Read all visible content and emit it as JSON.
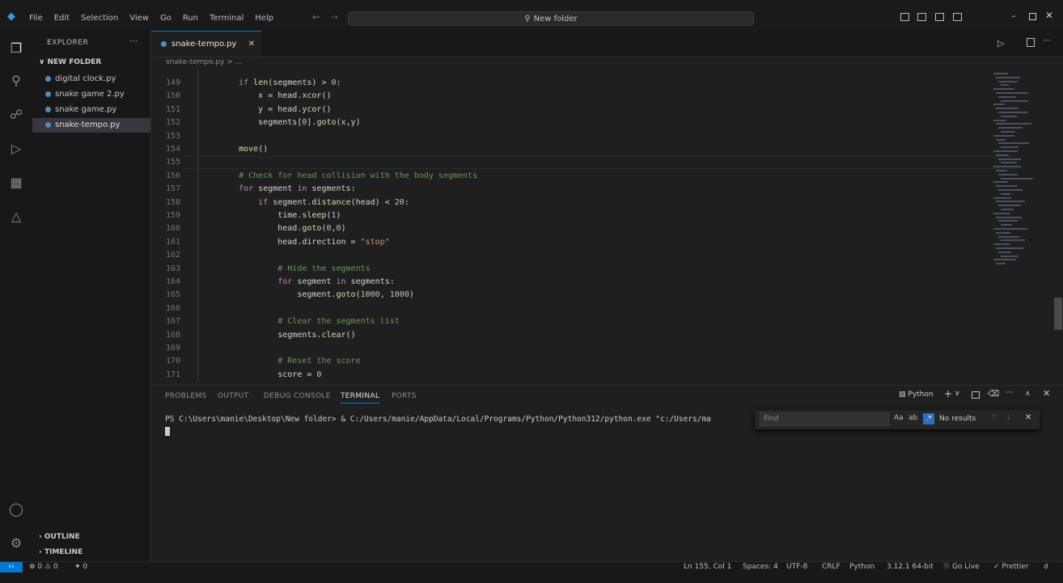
{
  "menu": [
    "File",
    "Edit",
    "Selection",
    "View",
    "Go",
    "Run",
    "Terminal",
    "Help"
  ],
  "command_center": "New folder",
  "sidebar": {
    "title": "EXPLORER",
    "folder": "NEW FOLDER",
    "files": [
      "digital clock.py",
      "snake game 2.py",
      "snake game.py",
      "snake-tempo.py"
    ],
    "sections": [
      "OUTLINE",
      "TIMELINE"
    ]
  },
  "tab": {
    "label": "snake-tempo.py"
  },
  "breadcrumb": "snake-tempo.py > ...",
  "code_lines": [
    {
      "n": "149",
      "t": "    if len(segments) > 0:"
    },
    {
      "n": "150",
      "t": "        x = head.xcor()"
    },
    {
      "n": "151",
      "t": "        y = head.ycor()"
    },
    {
      "n": "152",
      "t": "        segments[0].goto(x,y)"
    },
    {
      "n": "153",
      "t": ""
    },
    {
      "n": "154",
      "t": "    move()"
    },
    {
      "n": "155",
      "t": ""
    },
    {
      "n": "156",
      "t": "    # Check for head collision with the body segments"
    },
    {
      "n": "157",
      "t": "    for segment in segments:"
    },
    {
      "n": "158",
      "t": "        if segment.distance(head) < 20:"
    },
    {
      "n": "159",
      "t": "            time.sleep(1)"
    },
    {
      "n": "160",
      "t": "            head.goto(0,0)"
    },
    {
      "n": "161",
      "t": "            head.direction = \"stop\""
    },
    {
      "n": "162",
      "t": ""
    },
    {
      "n": "163",
      "t": "            # Hide the segments"
    },
    {
      "n": "164",
      "t": "            for segment in segments:"
    },
    {
      "n": "165",
      "t": "                segment.goto(1000, 1000)"
    },
    {
      "n": "166",
      "t": ""
    },
    {
      "n": "167",
      "t": "            # Clear the segments list"
    },
    {
      "n": "168",
      "t": "            segments.clear()"
    },
    {
      "n": "169",
      "t": ""
    },
    {
      "n": "170",
      "t": "            # Reset the score"
    },
    {
      "n": "171",
      "t": "            score = 0"
    }
  ],
  "panel": {
    "tabs": [
      "PROBLEMS",
      "OUTPUT",
      "DEBUG CONSOLE",
      "TERMINAL",
      "PORTS"
    ],
    "active_tab": "TERMINAL",
    "terminal_label": "Python",
    "terminal_line": "PS C:\\Users\\manie\\Desktop\\New folder> & C:/Users/manie/AppData/Local/Programs/Python/Python312/python.exe \"c:/Users/ma",
    "find_placeholder": "Find",
    "find_result": "No results"
  },
  "status": {
    "errors": "0",
    "warnings": "0",
    "ports": "0",
    "position": "Ln 155, Col 1",
    "spaces": "Spaces: 4",
    "encoding": "UTF-8",
    "eol": "CRLF",
    "language": "Python",
    "interpreter": "3.12.1 64-bit",
    "golive": "Go Live",
    "prettier": "Prettier"
  }
}
